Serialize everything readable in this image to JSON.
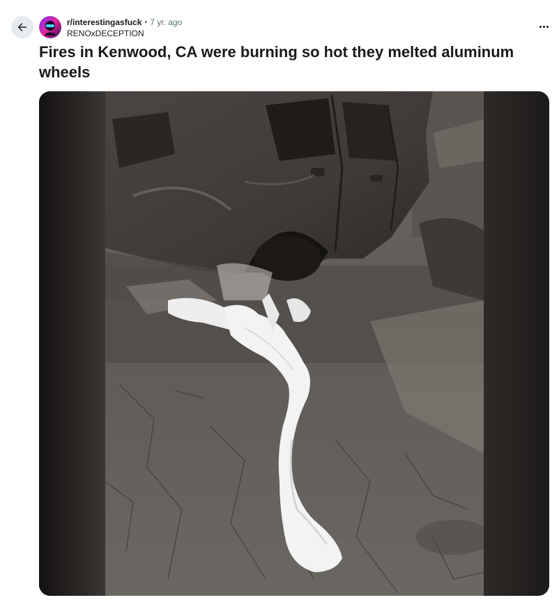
{
  "post": {
    "subreddit": "r/interestingasfuck",
    "separator": "•",
    "time_ago": "7 yr. ago",
    "author": "RENOxDECEPTION",
    "title": "Fires in Kenwood, CA were burning so hot they melted aluminum wheels"
  },
  "icons": {
    "back": "arrow-left-icon",
    "more": "ellipsis-horizontal-icon"
  },
  "colors": {
    "back_button_bg": "#e5ebee",
    "meta_gray": "#576f76",
    "text": "#1a1a1b"
  }
}
